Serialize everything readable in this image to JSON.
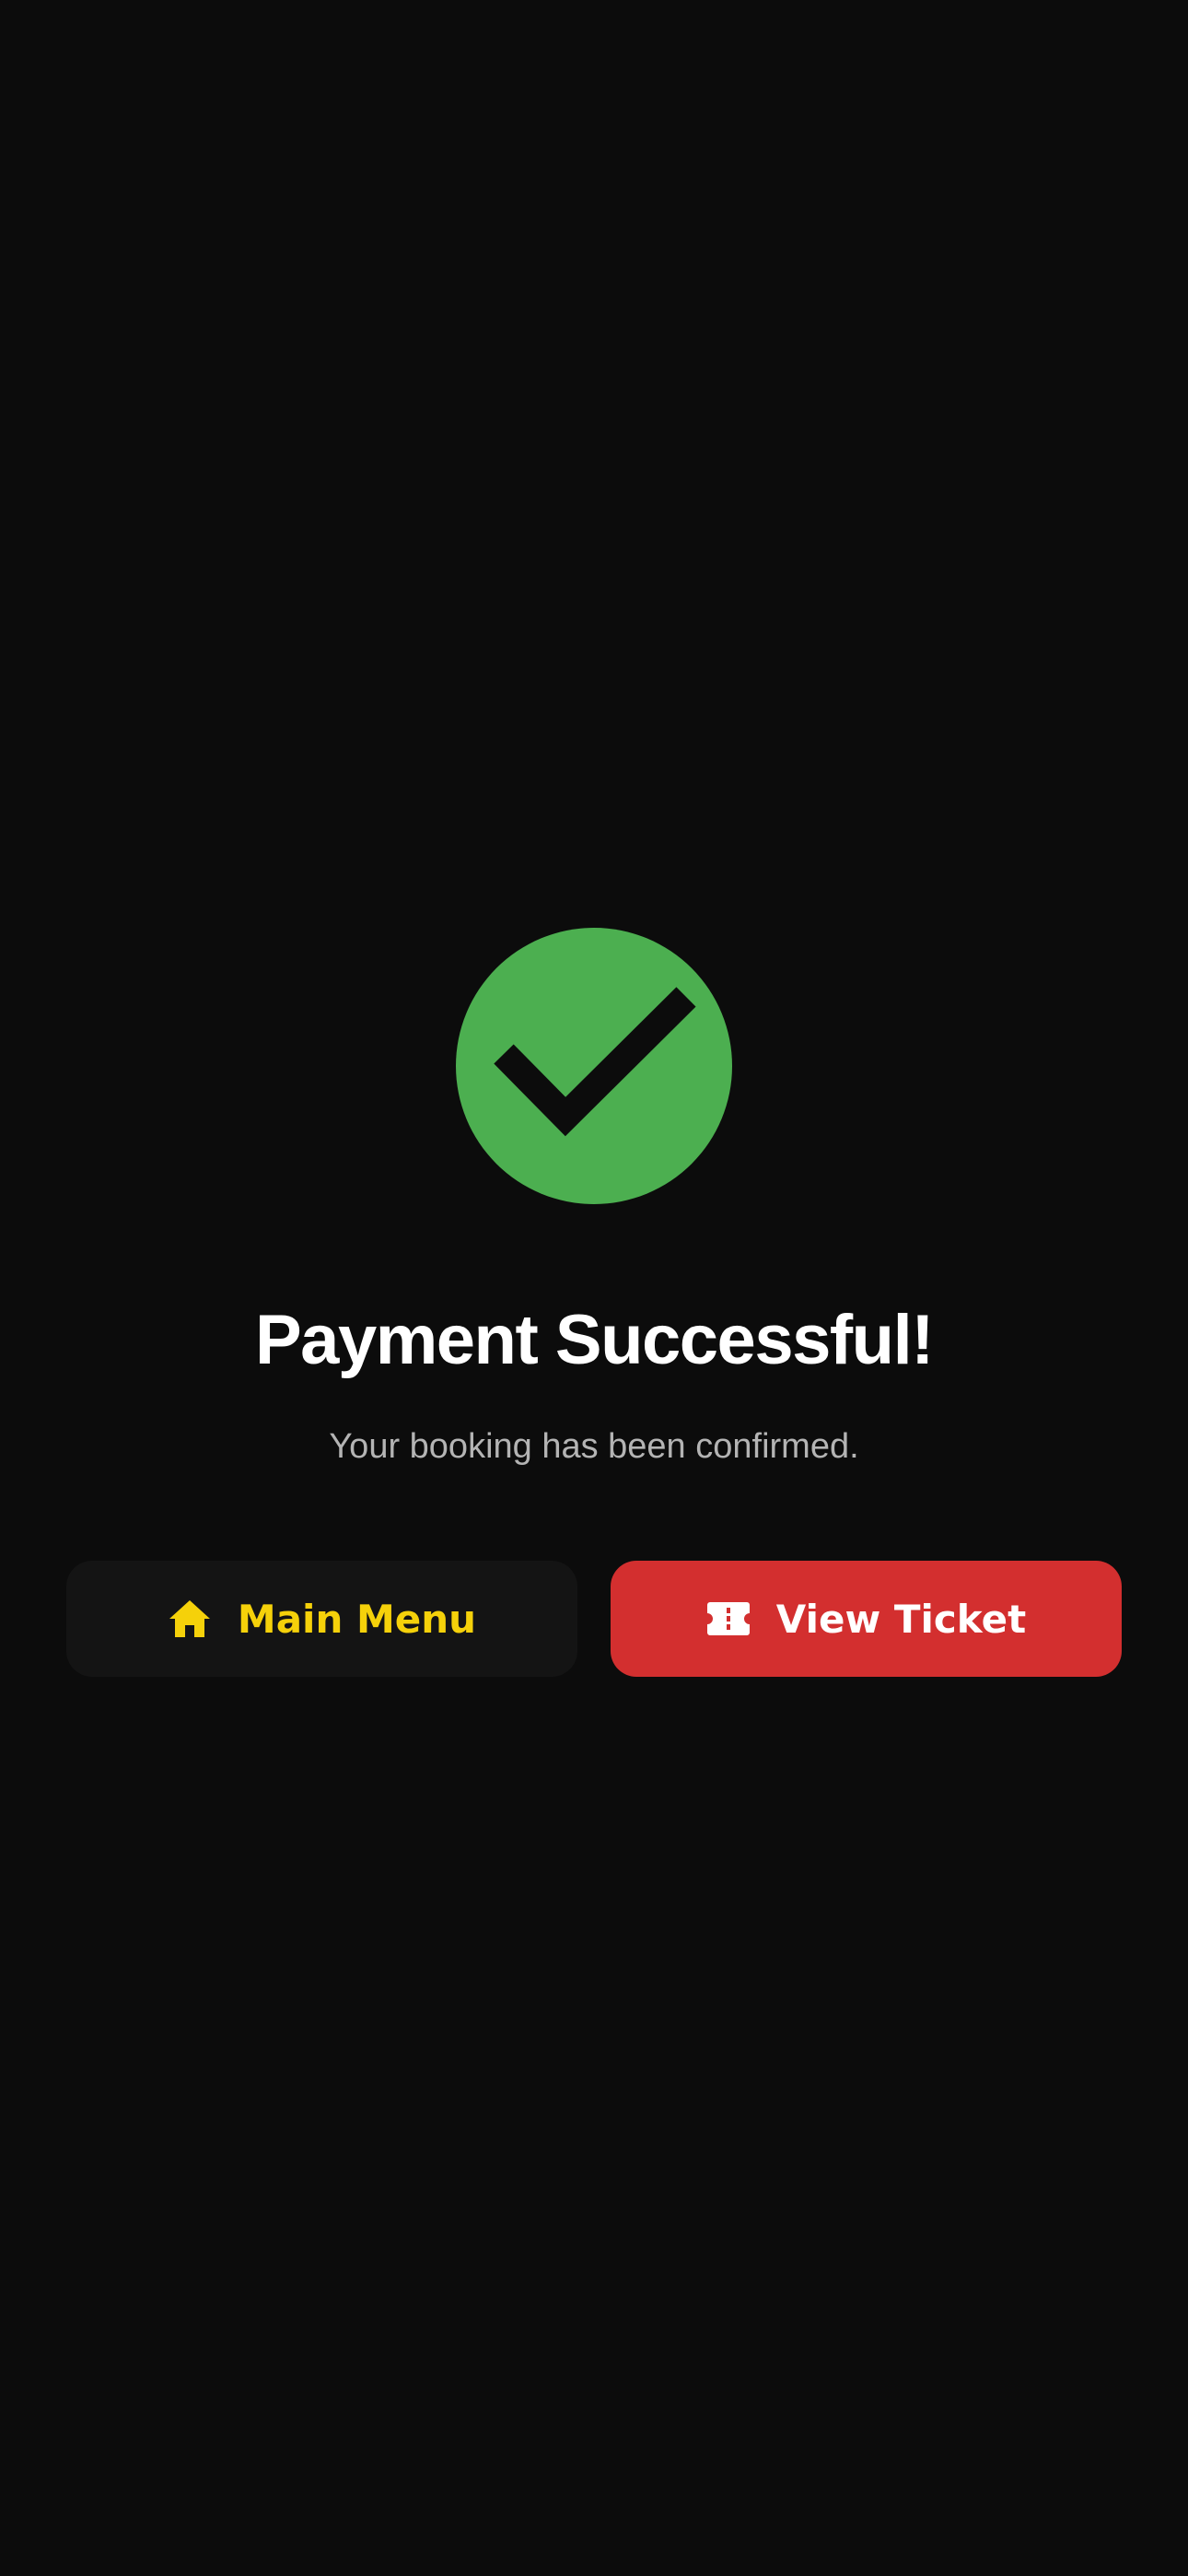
{
  "status": {
    "icon": "check-circle-icon",
    "color": "#4caf50"
  },
  "title": "Payment Successful!",
  "subtitle": "Your booking has been confirmed.",
  "actions": {
    "main_menu": {
      "label": "Main Menu",
      "icon": "home-icon",
      "text_color": "#f5d10a",
      "background": "#141414"
    },
    "view_ticket": {
      "label": "View Ticket",
      "icon": "ticket-icon",
      "text_color": "#ffffff",
      "background": "#d32f2f"
    }
  },
  "colors": {
    "background": "#0c0c0c",
    "subtitle": "#b4b4b4"
  }
}
